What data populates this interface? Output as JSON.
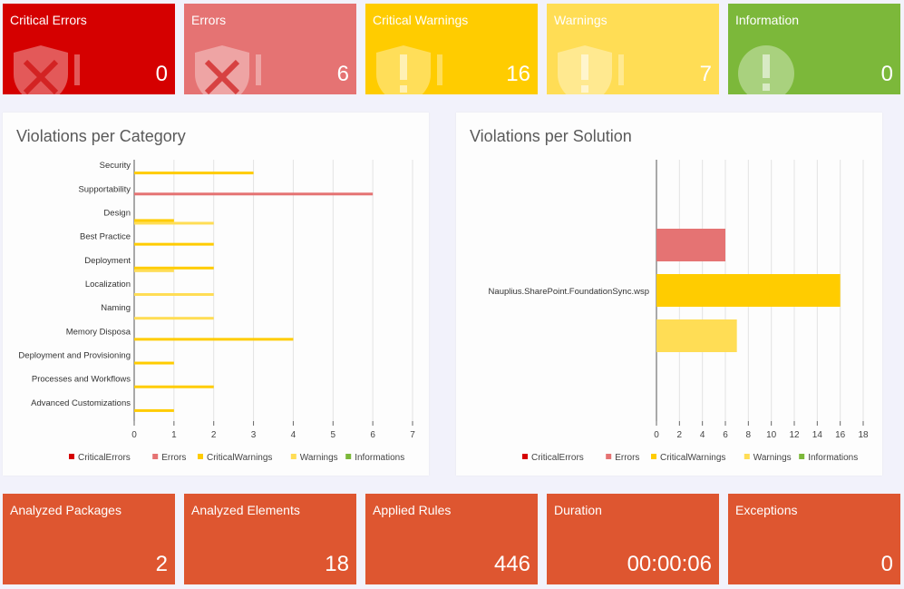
{
  "top_tiles": [
    {
      "title": "Critical Errors",
      "value": "0",
      "color": "#d50000",
      "icon": "shield-x-icon"
    },
    {
      "title": "Errors",
      "value": "6",
      "color": "#e57373",
      "icon": "shield-x-icon"
    },
    {
      "title": "Critical Warnings",
      "value": "16",
      "color": "#ffcc00",
      "icon": "shield-exclamation-icon"
    },
    {
      "title": "Warnings",
      "value": "7",
      "color": "#ffdd55",
      "icon": "shield-exclamation-icon"
    },
    {
      "title": "Information",
      "value": "0",
      "color": "#7cb83a",
      "icon": "info-circle-icon"
    }
  ],
  "bottom_tiles": [
    {
      "title": "Analyzed Packages",
      "value": "2"
    },
    {
      "title": "Analyzed Elements",
      "value": "18"
    },
    {
      "title": "Applied Rules",
      "value": "446"
    },
    {
      "title": "Duration",
      "value": "00:00:06"
    },
    {
      "title": "Exceptions",
      "value": "0"
    }
  ],
  "bottom_tile_color": "#de5630",
  "chart_data": [
    {
      "type": "bar",
      "orientation": "horizontal",
      "title": "Violations per Category",
      "categories": [
        "Security",
        "Supportability",
        "Design",
        "Best Practice",
        "Deployment",
        "Localization",
        "Naming",
        "Memory Disposa",
        "Deployment and Provisioning",
        "Processes and Workflows",
        "Advanced Customizations"
      ],
      "series": [
        {
          "name": "CriticalErrors",
          "color": "#d50000",
          "values": [
            0,
            0,
            0,
            0,
            0,
            0,
            0,
            0,
            0,
            0,
            0
          ]
        },
        {
          "name": "Errors",
          "color": "#e57373",
          "values": [
            0,
            6,
            0,
            0,
            0,
            0,
            0,
            0,
            0,
            0,
            0
          ]
        },
        {
          "name": "CriticalWarnings",
          "color": "#ffcc00",
          "values": [
            3,
            0,
            1,
            2,
            2,
            0,
            0,
            4,
            1,
            2,
            1
          ]
        },
        {
          "name": "Warnings",
          "color": "#ffdd55",
          "values": [
            0,
            0,
            2,
            0,
            1,
            2,
            2,
            0,
            0,
            0,
            0
          ]
        },
        {
          "name": "Informations",
          "color": "#7cb83a",
          "values": [
            0,
            0,
            0,
            0,
            0,
            0,
            0,
            0,
            0,
            0,
            0
          ]
        }
      ],
      "xlim": [
        0,
        7
      ],
      "ticks": [
        "0",
        "1",
        "2",
        "3",
        "4",
        "5",
        "6",
        "7"
      ],
      "legend_labels": [
        "CriticalErrors",
        "Errors",
        "CriticalWarnings",
        "Warnings",
        "Informations"
      ],
      "grid": true,
      "legend": "bottom"
    },
    {
      "type": "bar",
      "orientation": "horizontal",
      "title": "Violations per Solution",
      "categories": [
        "Nauplius.SharePoint.FoundationSync.wsp"
      ],
      "series": [
        {
          "name": "CriticalErrors",
          "color": "#d50000",
          "values": [
            0
          ]
        },
        {
          "name": "Errors",
          "color": "#e57373",
          "values": [
            6
          ]
        },
        {
          "name": "CriticalWarnings",
          "color": "#ffcc00",
          "values": [
            16
          ]
        },
        {
          "name": "Warnings",
          "color": "#ffdd55",
          "values": [
            7
          ]
        },
        {
          "name": "Informations",
          "color": "#7cb83a",
          "values": [
            0
          ]
        }
      ],
      "xlim": [
        0,
        18
      ],
      "ticks": [
        "0",
        "2",
        "4",
        "6",
        "8",
        "10",
        "12",
        "14",
        "16",
        "18"
      ],
      "legend_labels": [
        "CriticalErrors",
        "Errors",
        "CriticalWarnings",
        "Warnings",
        "Informations"
      ],
      "grid": true,
      "legend": "bottom"
    }
  ]
}
